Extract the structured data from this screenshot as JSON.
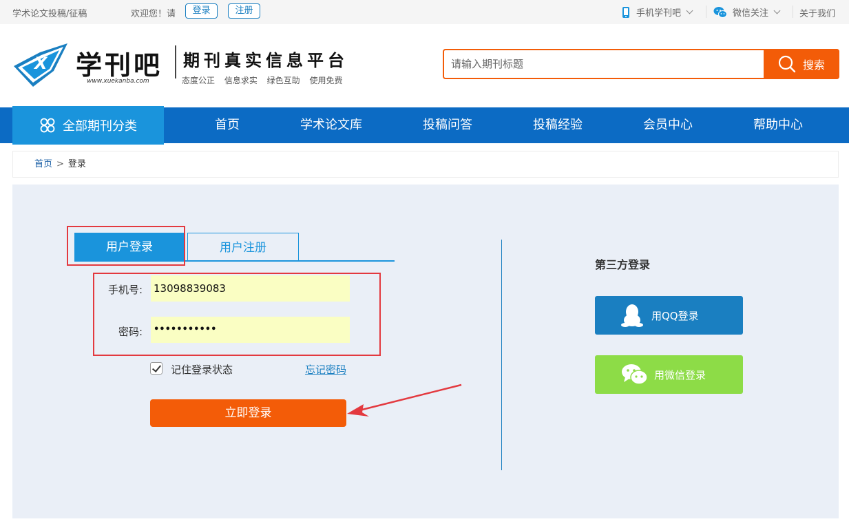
{
  "topbar": {
    "site_link": "学术论文投稿/征稿",
    "welcome": "欢迎您！请",
    "login": "登录",
    "register": "注册",
    "mobile": "手机学刊吧",
    "wechat": "微信关注",
    "about": "关于我们"
  },
  "header": {
    "logo_name": "学刊吧",
    "logo_url": "www.xuekanba.com",
    "slogan": "期刊真实信息平台",
    "tags": "态度公正 信息求实 绿色互助 使用免费",
    "search_placeholder": "请输入期刊标题",
    "search_button": "搜索"
  },
  "nav": {
    "all_categories": "全部期刊分类",
    "items": [
      "首页",
      "学术论文库",
      "投稿问答",
      "投稿经验",
      "会员中心",
      "帮助中心"
    ]
  },
  "breadcrumb": {
    "home": "首页",
    "separator": ">",
    "current": "登录"
  },
  "login": {
    "tab_login": "用户登录",
    "tab_register": "用户注册",
    "phone_label": "手机号:",
    "phone_value": "13098839083",
    "password_label": "密码:",
    "password_value": "•••••••••••",
    "remember": "记住登录状态",
    "forgot": "忘记密码",
    "submit": "立即登录"
  },
  "third_party": {
    "title": "第三方登录",
    "qq": "用QQ登录",
    "wechat": "用微信登录"
  },
  "colors": {
    "primary_blue": "#0c6bc4",
    "light_blue": "#1a94dc",
    "orange": "#f35c08",
    "wechat_green": "#8ddc47",
    "annotation_red": "#e3393f",
    "main_bg": "#eaeff7"
  }
}
